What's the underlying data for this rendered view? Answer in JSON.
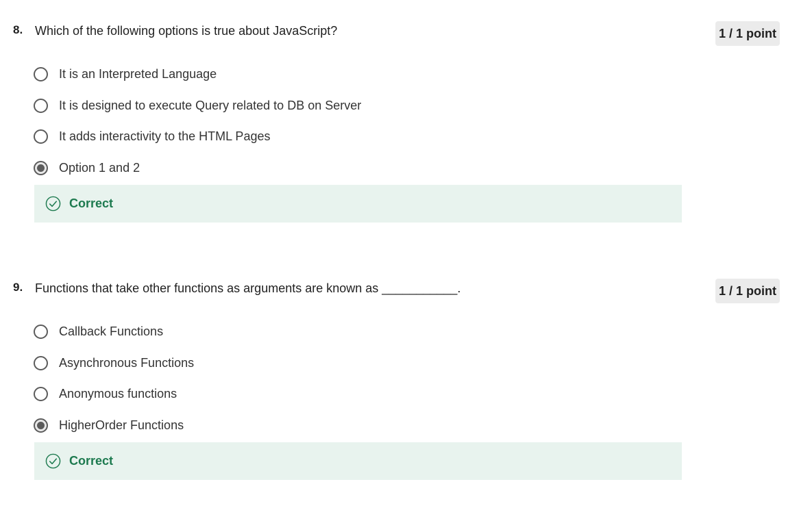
{
  "colors": {
    "correct_green": "#1d7a4f",
    "feedback_bg": "#e8f3ee",
    "badge_bg": "#ebebeb",
    "radio_gray": "#5b5b5b"
  },
  "questions": [
    {
      "number": "8.",
      "prompt": "Which of the following options is true about JavaScript?",
      "points": "1 / 1 point",
      "options": [
        {
          "label": "It is an Interpreted Language",
          "selected": false
        },
        {
          "label": "It is designed to execute Query related to DB on Server",
          "selected": false
        },
        {
          "label": "It adds interactivity to the HTML Pages",
          "selected": false
        },
        {
          "label": "Option 1 and 2",
          "selected": true
        }
      ],
      "feedback": {
        "label": "Correct",
        "icon": "check-circle-icon"
      }
    },
    {
      "number": "9.",
      "prompt": "Functions that take other functions as arguments are known as ___________.",
      "points": "1 / 1 point",
      "options": [
        {
          "label": "Callback Functions",
          "selected": false
        },
        {
          "label": "Asynchronous Functions",
          "selected": false
        },
        {
          "label": "Anonymous functions",
          "selected": false
        },
        {
          "label": "HigherOrder Functions",
          "selected": true
        }
      ],
      "feedback": {
        "label": "Correct",
        "icon": "check-circle-icon"
      }
    }
  ]
}
